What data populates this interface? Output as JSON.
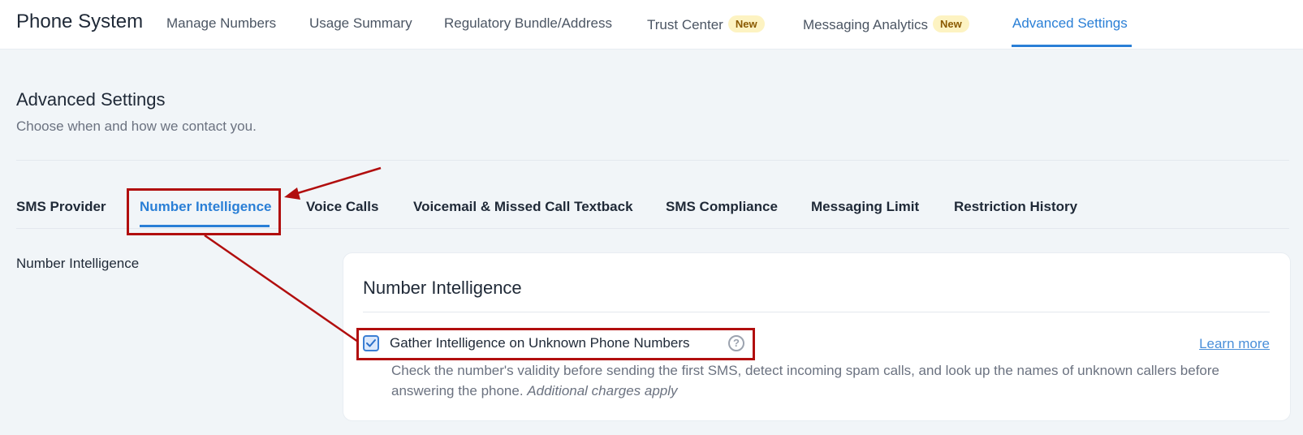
{
  "topbar": {
    "brand": "Phone System",
    "tabs": [
      {
        "label": "Manage Numbers"
      },
      {
        "label": "Usage Summary"
      },
      {
        "label": "Regulatory Bundle/Address"
      },
      {
        "label": "Trust Center",
        "badge": "New"
      },
      {
        "label": "Messaging Analytics",
        "badge": "New"
      },
      {
        "label": "Advanced Settings",
        "active": true
      }
    ]
  },
  "header": {
    "title": "Advanced Settings",
    "subtitle": "Choose when and how we contact you."
  },
  "settings_tabs": [
    {
      "label": "SMS Provider"
    },
    {
      "label": "Number Intelligence",
      "active": true
    },
    {
      "label": "Voice Calls"
    },
    {
      "label": "Voicemail & Missed Call Textback"
    },
    {
      "label": "SMS Compliance"
    },
    {
      "label": "Messaging Limit"
    },
    {
      "label": "Restriction History"
    }
  ],
  "section": {
    "label": "Number Intelligence",
    "card_title": "Number Intelligence",
    "option": {
      "label": "Gather Intelligence on Unknown Phone Numbers",
      "checked": true,
      "help_icon": "question-circle-icon",
      "learn_more": "Learn more",
      "description": "Check the number's validity before sending the first SMS, detect incoming spam calls, and look up the names of unknown callers before answering the phone.",
      "note": "Additional charges apply"
    }
  },
  "colors": {
    "accent": "#2a7fd6",
    "annotation": "#b10e0e",
    "badge_bg": "#fdf3c2"
  }
}
